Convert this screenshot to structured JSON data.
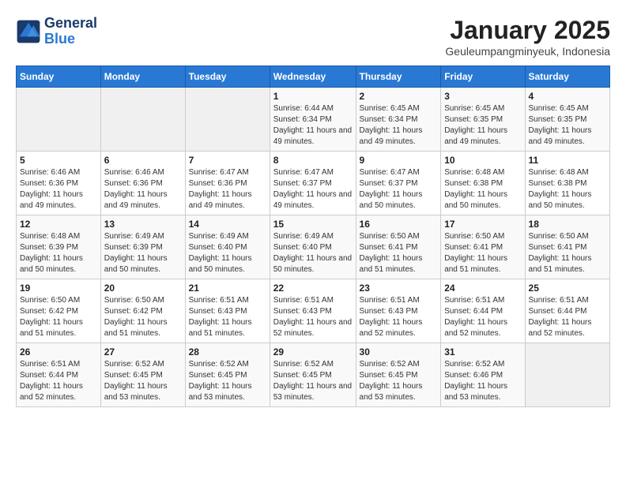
{
  "header": {
    "logo_line1": "General",
    "logo_line2": "Blue",
    "month": "January 2025",
    "location": "Geuleumpangminyeuk, Indonesia"
  },
  "weekdays": [
    "Sunday",
    "Monday",
    "Tuesday",
    "Wednesday",
    "Thursday",
    "Friday",
    "Saturday"
  ],
  "weeks": [
    [
      {
        "day": "",
        "info": ""
      },
      {
        "day": "",
        "info": ""
      },
      {
        "day": "",
        "info": ""
      },
      {
        "day": "1",
        "info": "Sunrise: 6:44 AM\nSunset: 6:34 PM\nDaylight: 11 hours and 49 minutes."
      },
      {
        "day": "2",
        "info": "Sunrise: 6:45 AM\nSunset: 6:34 PM\nDaylight: 11 hours and 49 minutes."
      },
      {
        "day": "3",
        "info": "Sunrise: 6:45 AM\nSunset: 6:35 PM\nDaylight: 11 hours and 49 minutes."
      },
      {
        "day": "4",
        "info": "Sunrise: 6:45 AM\nSunset: 6:35 PM\nDaylight: 11 hours and 49 minutes."
      }
    ],
    [
      {
        "day": "5",
        "info": "Sunrise: 6:46 AM\nSunset: 6:36 PM\nDaylight: 11 hours and 49 minutes."
      },
      {
        "day": "6",
        "info": "Sunrise: 6:46 AM\nSunset: 6:36 PM\nDaylight: 11 hours and 49 minutes."
      },
      {
        "day": "7",
        "info": "Sunrise: 6:47 AM\nSunset: 6:36 PM\nDaylight: 11 hours and 49 minutes."
      },
      {
        "day": "8",
        "info": "Sunrise: 6:47 AM\nSunset: 6:37 PM\nDaylight: 11 hours and 49 minutes."
      },
      {
        "day": "9",
        "info": "Sunrise: 6:47 AM\nSunset: 6:37 PM\nDaylight: 11 hours and 50 minutes."
      },
      {
        "day": "10",
        "info": "Sunrise: 6:48 AM\nSunset: 6:38 PM\nDaylight: 11 hours and 50 minutes."
      },
      {
        "day": "11",
        "info": "Sunrise: 6:48 AM\nSunset: 6:38 PM\nDaylight: 11 hours and 50 minutes."
      }
    ],
    [
      {
        "day": "12",
        "info": "Sunrise: 6:48 AM\nSunset: 6:39 PM\nDaylight: 11 hours and 50 minutes."
      },
      {
        "day": "13",
        "info": "Sunrise: 6:49 AM\nSunset: 6:39 PM\nDaylight: 11 hours and 50 minutes."
      },
      {
        "day": "14",
        "info": "Sunrise: 6:49 AM\nSunset: 6:40 PM\nDaylight: 11 hours and 50 minutes."
      },
      {
        "day": "15",
        "info": "Sunrise: 6:49 AM\nSunset: 6:40 PM\nDaylight: 11 hours and 50 minutes."
      },
      {
        "day": "16",
        "info": "Sunrise: 6:50 AM\nSunset: 6:41 PM\nDaylight: 11 hours and 51 minutes."
      },
      {
        "day": "17",
        "info": "Sunrise: 6:50 AM\nSunset: 6:41 PM\nDaylight: 11 hours and 51 minutes."
      },
      {
        "day": "18",
        "info": "Sunrise: 6:50 AM\nSunset: 6:41 PM\nDaylight: 11 hours and 51 minutes."
      }
    ],
    [
      {
        "day": "19",
        "info": "Sunrise: 6:50 AM\nSunset: 6:42 PM\nDaylight: 11 hours and 51 minutes."
      },
      {
        "day": "20",
        "info": "Sunrise: 6:50 AM\nSunset: 6:42 PM\nDaylight: 11 hours and 51 minutes."
      },
      {
        "day": "21",
        "info": "Sunrise: 6:51 AM\nSunset: 6:43 PM\nDaylight: 11 hours and 51 minutes."
      },
      {
        "day": "22",
        "info": "Sunrise: 6:51 AM\nSunset: 6:43 PM\nDaylight: 11 hours and 52 minutes."
      },
      {
        "day": "23",
        "info": "Sunrise: 6:51 AM\nSunset: 6:43 PM\nDaylight: 11 hours and 52 minutes."
      },
      {
        "day": "24",
        "info": "Sunrise: 6:51 AM\nSunset: 6:44 PM\nDaylight: 11 hours and 52 minutes."
      },
      {
        "day": "25",
        "info": "Sunrise: 6:51 AM\nSunset: 6:44 PM\nDaylight: 11 hours and 52 minutes."
      }
    ],
    [
      {
        "day": "26",
        "info": "Sunrise: 6:51 AM\nSunset: 6:44 PM\nDaylight: 11 hours and 52 minutes."
      },
      {
        "day": "27",
        "info": "Sunrise: 6:52 AM\nSunset: 6:45 PM\nDaylight: 11 hours and 53 minutes."
      },
      {
        "day": "28",
        "info": "Sunrise: 6:52 AM\nSunset: 6:45 PM\nDaylight: 11 hours and 53 minutes."
      },
      {
        "day": "29",
        "info": "Sunrise: 6:52 AM\nSunset: 6:45 PM\nDaylight: 11 hours and 53 minutes."
      },
      {
        "day": "30",
        "info": "Sunrise: 6:52 AM\nSunset: 6:45 PM\nDaylight: 11 hours and 53 minutes."
      },
      {
        "day": "31",
        "info": "Sunrise: 6:52 AM\nSunset: 6:46 PM\nDaylight: 11 hours and 53 minutes."
      },
      {
        "day": "",
        "info": ""
      }
    ]
  ]
}
